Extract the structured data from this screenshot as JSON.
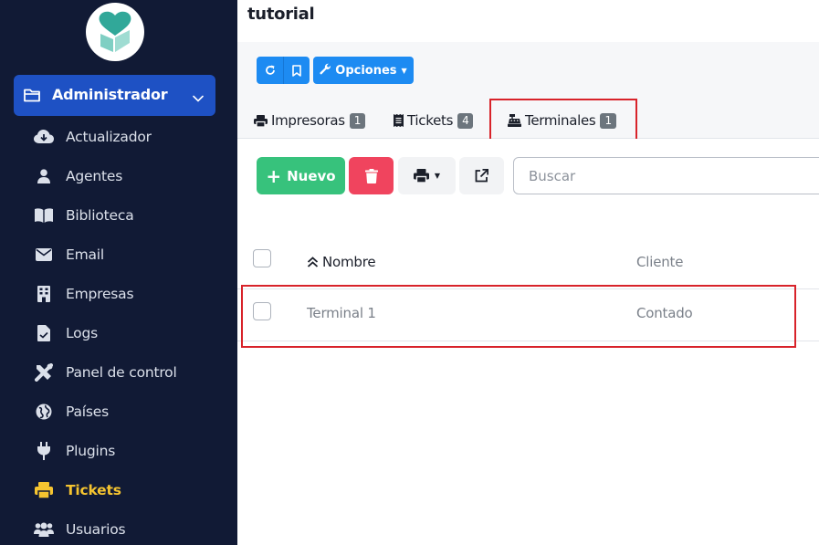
{
  "page": {
    "title": "tutorial"
  },
  "sidebar": {
    "section": {
      "label": "Administrador"
    },
    "items": [
      {
        "label": "Actualizador",
        "icon": "cloud-download-icon"
      },
      {
        "label": "Agentes",
        "icon": "user-icon"
      },
      {
        "label": "Biblioteca",
        "icon": "book-icon"
      },
      {
        "label": "Email",
        "icon": "envelope-icon"
      },
      {
        "label": "Empresas",
        "icon": "building-icon"
      },
      {
        "label": "Logs",
        "icon": "file-icon"
      },
      {
        "label": "Panel de control",
        "icon": "tools-icon"
      },
      {
        "label": "Países",
        "icon": "globe-icon"
      },
      {
        "label": "Plugins",
        "icon": "plug-icon"
      },
      {
        "label": "Tickets",
        "icon": "print-icon",
        "active": true
      },
      {
        "label": "Usuarios",
        "icon": "users-icon"
      }
    ]
  },
  "toolbar": {
    "options_label": "Opciones"
  },
  "tabs": [
    {
      "label": "Impresoras",
      "count": "1",
      "icon": "print-icon"
    },
    {
      "label": "Tickets",
      "count": "4",
      "icon": "receipt-icon"
    },
    {
      "label": "Terminales",
      "count": "1",
      "icon": "cash-register-icon",
      "active": true
    }
  ],
  "actions": {
    "new_label": "Nuevo",
    "search_placeholder": "Buscar"
  },
  "table": {
    "columns": [
      "Nombre",
      "Cliente"
    ],
    "rows": [
      {
        "nombre": "Terminal 1",
        "cliente": "Contado"
      }
    ]
  },
  "colors": {
    "sidebar_bg": "#111a35",
    "section_bg": "#1e51c4",
    "active_item": "#f5c430",
    "primary": "#1d8bf2",
    "success": "#37c27c",
    "danger": "#f0445e",
    "highlight": "#d8232a"
  }
}
